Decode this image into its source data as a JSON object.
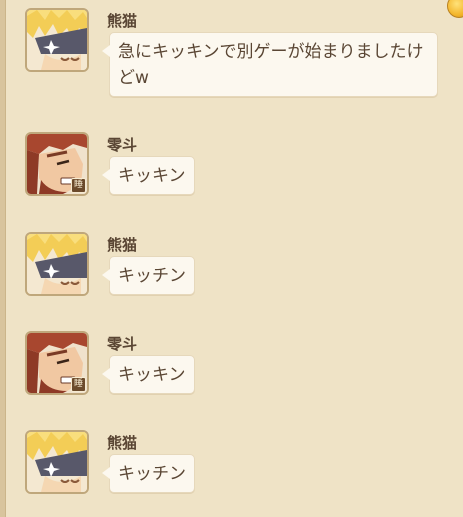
{
  "chat": {
    "messages": [
      {
        "sender": "熊猫",
        "avatar": "blonde-character-avatar-icon",
        "text": "急にキッキンで別ゲーが始まりましたけどw",
        "badge": ""
      },
      {
        "sender": "零斗",
        "avatar": "redhead-character-avatar-icon",
        "text": "キッキン",
        "badge": "睡"
      },
      {
        "sender": "熊猫",
        "avatar": "blonde-character-avatar-icon",
        "text": "キッチン",
        "badge": ""
      },
      {
        "sender": "零斗",
        "avatar": "redhead-character-avatar-icon",
        "text": "キッキン",
        "badge": "睡"
      },
      {
        "sender": "熊猫",
        "avatar": "blonde-character-avatar-icon",
        "text": "キッチン",
        "badge": ""
      }
    ]
  },
  "colors": {
    "background": "#efe3c6",
    "bubble": "#fcf8ef",
    "text": "#5a4634",
    "accent_gold": "#f3b52a"
  }
}
